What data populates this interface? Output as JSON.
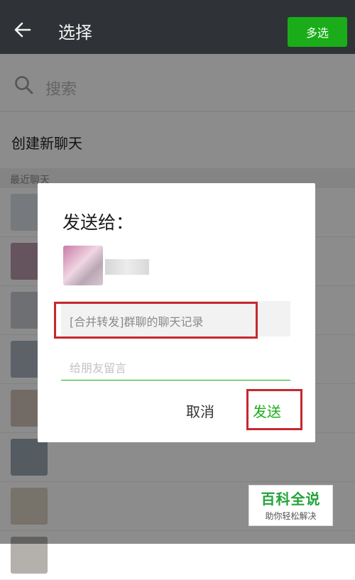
{
  "header": {
    "title": "选择",
    "multi_select_label": "多选"
  },
  "search": {
    "placeholder": "搜索"
  },
  "new_chat": {
    "label": "创建新聊天"
  },
  "recent_section": {
    "label": "最近聊天"
  },
  "recent_list": [
    {
      "avatar_color": "#d7dce3",
      "name": ""
    },
    {
      "avatar_color": "#b89aa9",
      "name": ""
    },
    {
      "avatar_color": "#c8cbd2",
      "name": ""
    },
    {
      "avatar_color": "#aab3bf",
      "name": ""
    },
    {
      "avatar_color": "#cfc4b9",
      "name": ""
    },
    {
      "avatar_color": "#9aa7b1",
      "name": ""
    },
    {
      "avatar_color": "#d9d0c2",
      "name": ""
    },
    {
      "avatar_color": "#b4b1ad",
      "name": ""
    }
  ],
  "dialog": {
    "title": "发送给：",
    "forward_preview": "[合并转发]群聊的聊天记录",
    "message_placeholder": "给朋友留言",
    "cancel_label": "取消",
    "send_label": "发送"
  },
  "watermark": {
    "main": "百科全说",
    "sub": "助你轻松解决"
  },
  "colors": {
    "header_bg": "#2f3236",
    "brand_green": "#1aad19",
    "highlight_red": "#c6282e"
  }
}
